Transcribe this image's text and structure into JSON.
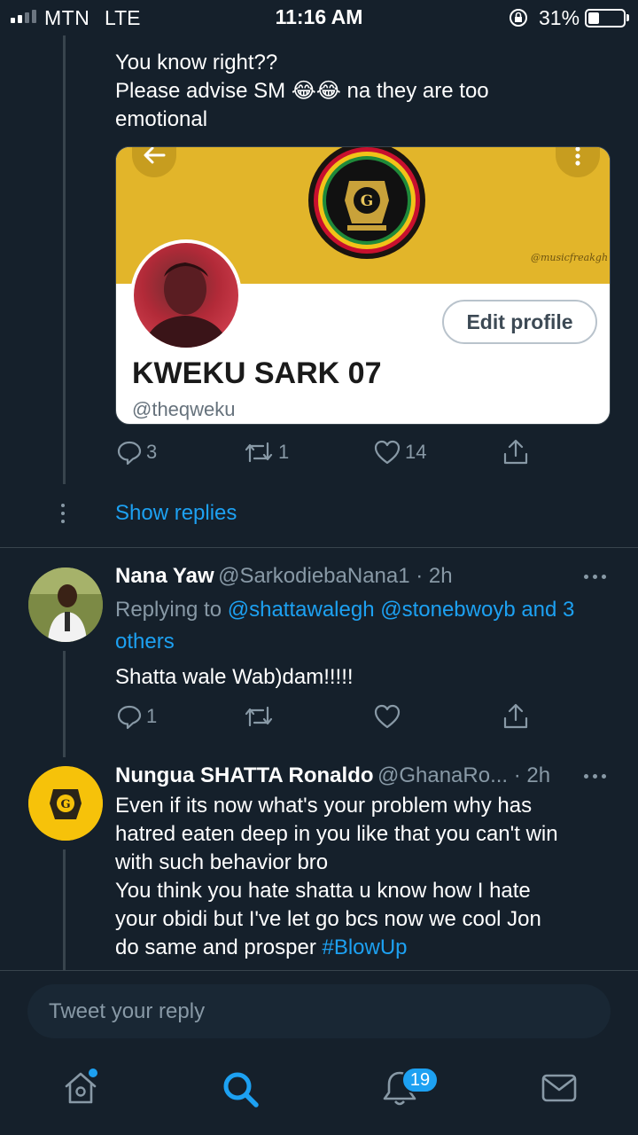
{
  "status_bar": {
    "carrier": "MTN",
    "network": "LTE",
    "time": "11:16 AM",
    "battery_percent": "31%",
    "icons": [
      "signal-icon",
      "orientation-lock-icon",
      "battery-icon"
    ]
  },
  "tweet_top": {
    "text_line1": "You know right??",
    "text_line2_a": "Please advise SM",
    "text_line2_emoji": "😂😂",
    "text_line2_b": "na they are too",
    "text_line3": "emotional",
    "card": {
      "name": "KWEKU SARK 07",
      "handle": "@theqweku",
      "button": "Edit profile",
      "signature": "@musicfreakgh"
    },
    "replies": "3",
    "retweets": "1",
    "likes": "14"
  },
  "show_replies": "Show replies",
  "tweet_nana": {
    "name": "Nana Yaw",
    "handle_time": "@SarkodiebaNana1 · 2h",
    "replying_prefix": "Replying to",
    "replying_line1": "@shattawalegh @stonebwoyb and 3",
    "replying_line2": "others",
    "text": "Shatta wale Wab)dam!!!!!",
    "replies": "1"
  },
  "tweet_nungua": {
    "name": "Nungua SHATTA Ronaldo",
    "handle_time": "@GhanaRo... · 2h",
    "lines": [
      "Even if its now what's your problem why has",
      "hatred eaten deep in you like that you can't win",
      "with such behavior bro",
      "You think you hate shatta u know how I hate",
      "your obidi but I've let go bcs now we cool Jon"
    ],
    "last_line_text": "do same and prosper",
    "hashtag": "#BlowUp"
  },
  "reply_bar": {
    "placeholder": "Tweet your reply"
  },
  "tab_bar": {
    "notifications_badge": "19",
    "tabs": [
      "home-icon",
      "search-icon",
      "notifications-icon",
      "messages-icon"
    ]
  },
  "colors": {
    "background": "#15202b",
    "accent": "#1da1f2",
    "secondary_text": "#8899a6",
    "divider": "#38444d"
  }
}
